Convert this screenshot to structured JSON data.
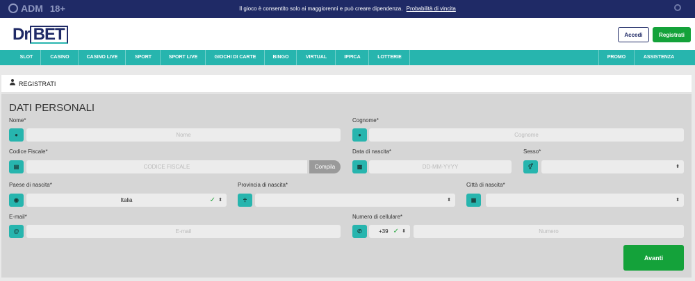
{
  "topbar": {
    "brand": "ADM",
    "age": "18+",
    "notice": "Il gioco è consentito solo ai maggiorenni e può creare dipendenza.",
    "notice_link": "Probabilità di vincita"
  },
  "header": {
    "logo_dr": "Dr",
    "logo_bet": "BET",
    "login_label": "Accedi",
    "register_label": "Registrati"
  },
  "nav": {
    "items": [
      "SLOT",
      "CASINO",
      "CASINO LIVE",
      "SPORT",
      "SPORT LIVE",
      "GIOCHI DI CARTE",
      "BINGO",
      "VIRTUAL",
      "IPPICA",
      "LOTTERIE"
    ],
    "right_items": [
      "PROMO",
      "ASSISTENZA"
    ]
  },
  "panel": {
    "title": "REGISTRATI",
    "section": "DATI PERSONALI"
  },
  "form": {
    "nome": {
      "label": "Nome*",
      "placeholder": "Nome"
    },
    "cognome": {
      "label": "Cognome*",
      "placeholder": "Cognome"
    },
    "codice_fiscale": {
      "label": "Codice Fiscale*",
      "placeholder": "CODICE FISCALE",
      "button": "Compila"
    },
    "data_nascita": {
      "label": "Data di nascita*",
      "placeholder": "DD-MM-YYYY"
    },
    "sesso": {
      "label": "Sesso*",
      "value": ""
    },
    "paese": {
      "label": "Paese di nascita*",
      "value": "Italia"
    },
    "provincia": {
      "label": "Provincia di nascita*",
      "value": ""
    },
    "citta": {
      "label": "Città di nascita*",
      "value": ""
    },
    "email": {
      "label": "E-mail*",
      "placeholder": "E-mail"
    },
    "cellulare": {
      "label": "Numero di cellulare*",
      "prefix": "+39",
      "placeholder": "Numero"
    },
    "submit": "Avanti"
  },
  "colors": {
    "navy": "#1f2a66",
    "teal": "#27b5ae",
    "green": "#14a23a"
  }
}
